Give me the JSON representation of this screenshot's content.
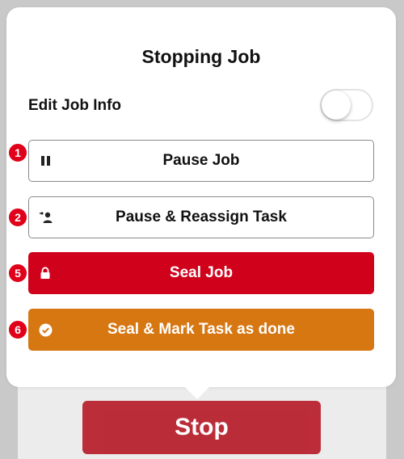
{
  "dialog": {
    "title": "Stopping Job",
    "edit_job_info": {
      "label": "Edit Job Info",
      "enabled": false
    }
  },
  "actions": [
    {
      "badge": "1",
      "label": "Pause Job",
      "icon": "pause-icon",
      "style": "outline"
    },
    {
      "badge": "2",
      "label": "Pause & Reassign Task",
      "icon": "reassign-user-icon",
      "style": "outline"
    },
    {
      "badge": "5",
      "label": "Seal Job",
      "icon": "lock-icon",
      "style": "red",
      "color": "#d0021b"
    },
    {
      "badge": "6",
      "label": "Seal & Mark Task as done",
      "icon": "check-circle-icon",
      "style": "orange",
      "color": "#d67712"
    }
  ],
  "footer": {
    "stop_label": "Stop",
    "stop_color": "#b71c2a"
  },
  "colors": {
    "badge": "#e0001a"
  }
}
